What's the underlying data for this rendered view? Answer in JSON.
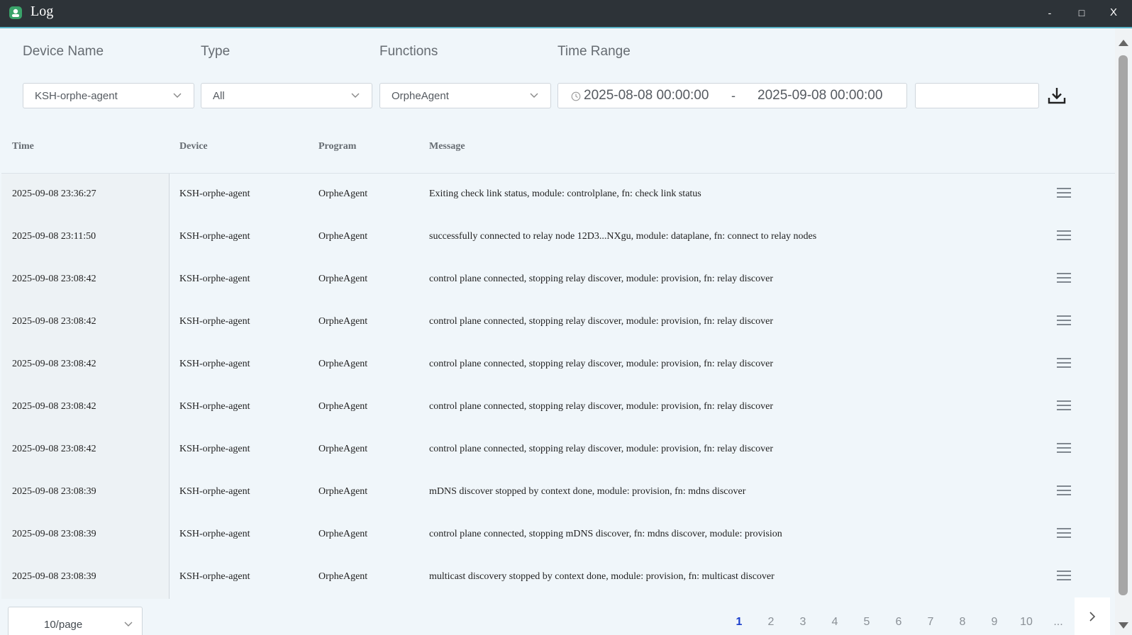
{
  "window": {
    "title": "Log",
    "minimize": "-",
    "maximize": "□",
    "close": "X"
  },
  "filters": {
    "device_name": {
      "label": "Device Name",
      "value": "KSH-orphe-agent"
    },
    "type": {
      "label": "Type",
      "value": "All"
    },
    "functions": {
      "label": "Functions",
      "value": "OrpheAgent"
    },
    "time_range": {
      "label": "Time Range",
      "start": "2025-08-08 00:00:00",
      "separator": "-",
      "end": "2025-09-08 00:00:00"
    },
    "search": {
      "value": ""
    }
  },
  "table": {
    "columns": [
      "Time",
      "Device",
      "Program",
      "Message"
    ],
    "rows": [
      {
        "time": "2025-09-08 23:36:27",
        "device": "KSH-orphe-agent",
        "program": "OrpheAgent",
        "message": "Exiting check link status, module: controlplane, fn: check link status"
      },
      {
        "time": "2025-09-08 23:11:50",
        "device": "KSH-orphe-agent",
        "program": "OrpheAgent",
        "message": "successfully connected to relay node 12D3...NXgu, module: dataplane, fn: connect to relay nodes"
      },
      {
        "time": "2025-09-08 23:08:42",
        "device": "KSH-orphe-agent",
        "program": "OrpheAgent",
        "message": "control plane connected, stopping relay discover, module: provision, fn: relay discover"
      },
      {
        "time": "2025-09-08 23:08:42",
        "device": "KSH-orphe-agent",
        "program": "OrpheAgent",
        "message": "control plane connected, stopping relay discover, module: provision, fn: relay discover"
      },
      {
        "time": "2025-09-08 23:08:42",
        "device": "KSH-orphe-agent",
        "program": "OrpheAgent",
        "message": "control plane connected, stopping relay discover, module: provision, fn: relay discover"
      },
      {
        "time": "2025-09-08 23:08:42",
        "device": "KSH-orphe-agent",
        "program": "OrpheAgent",
        "message": "control plane connected, stopping relay discover, module: provision, fn: relay discover"
      },
      {
        "time": "2025-09-08 23:08:42",
        "device": "KSH-orphe-agent",
        "program": "OrpheAgent",
        "message": "control plane connected, stopping relay discover, module: provision, fn: relay discover"
      },
      {
        "time": "2025-09-08 23:08:39",
        "device": "KSH-orphe-agent",
        "program": "OrpheAgent",
        "message": "mDNS discover stopped by context done, module: provision, fn: mdns discover"
      },
      {
        "time": "2025-09-08 23:08:39",
        "device": "KSH-orphe-agent",
        "program": "OrpheAgent",
        "message": "control plane connected, stopping mDNS discover, fn: mdns discover, module: provision"
      },
      {
        "time": "2025-09-08 23:08:39",
        "device": "KSH-orphe-agent",
        "program": "OrpheAgent",
        "message": "multicast discovery stopped by context done, module: provision, fn: multicast discover"
      }
    ]
  },
  "pagination": {
    "page_size": "10/page",
    "pages": [
      "1",
      "2",
      "3",
      "4",
      "5",
      "6",
      "7",
      "8",
      "9",
      "10"
    ],
    "current": "1",
    "ellipsis": "...",
    "next": "›"
  },
  "icons": {
    "app": "app-logo-icon",
    "clock": "clock-icon",
    "download": "download-icon",
    "row_menu": "hamburger-menu-icon",
    "chevron": "chevron-down-icon"
  },
  "colors": {
    "titlebar": "#2d3338",
    "titlebar_accent": "#5ab4c8",
    "background": "#f0f6fa",
    "active_page": "#1a3ecc",
    "app_icon": "#3aa36a"
  }
}
